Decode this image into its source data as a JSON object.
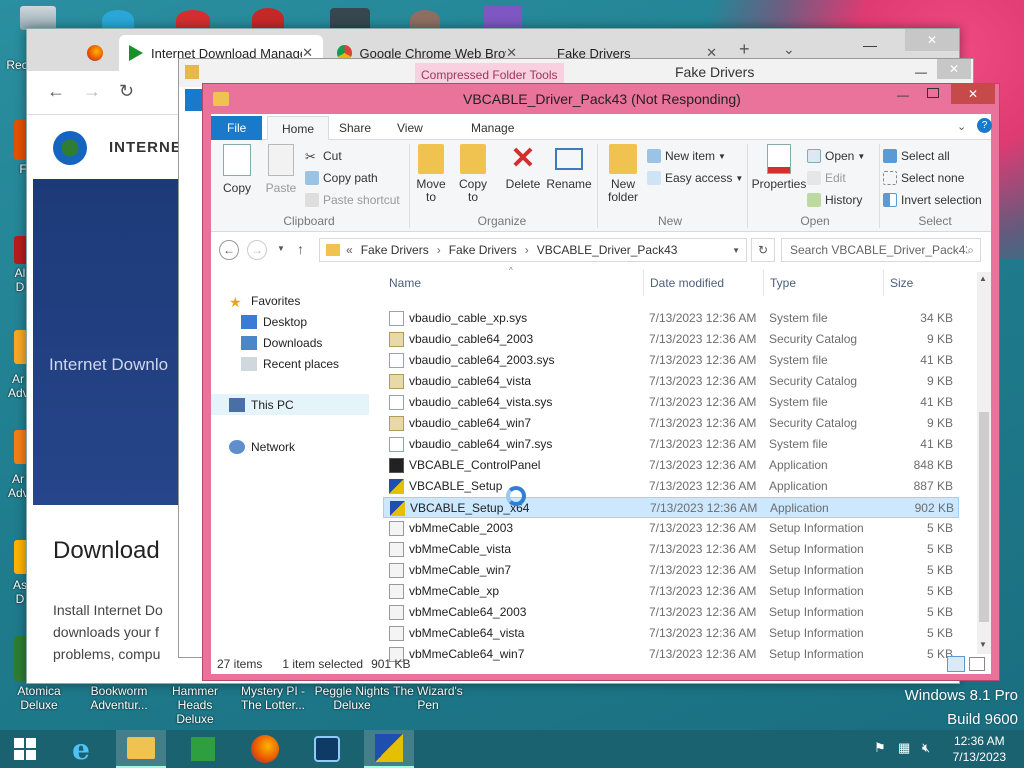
{
  "desktop": {
    "top_icons_labels": [],
    "left_icons": [
      {
        "label": "Rec",
        "name": "recycle-bin-icon"
      },
      {
        "label": "F",
        "name": "app-icon-f"
      },
      {
        "label": "Al D",
        "name": "app-icon-al"
      },
      {
        "label": "Ar Adv",
        "name": "app-icon-ar1"
      },
      {
        "label": "Ar Adv",
        "name": "app-icon-ar2"
      },
      {
        "label": "As D",
        "name": "app-icon-as"
      }
    ],
    "bottom_icons": [
      {
        "label": "Atomica Deluxe",
        "name": "atomica-deluxe-icon"
      },
      {
        "label": "Bookworm Adventur...",
        "name": "bookworm-icon"
      },
      {
        "label": "Hammer Heads Deluxe",
        "name": "hammer-heads-icon"
      },
      {
        "label": "Mystery PI - The Lotter...",
        "name": "mystery-pi-icon"
      },
      {
        "label": "Peggle Nights Deluxe",
        "name": "peggle-nights-icon"
      },
      {
        "label": "The Wizard's Pen",
        "name": "wizards-pen-icon"
      }
    ],
    "watermark_line1": "Windows 8.1 Pro",
    "watermark_line2": "Build 9600"
  },
  "taskbar": {
    "time": "12:36 AM",
    "date": "7/13/2023"
  },
  "browser": {
    "tabs": [
      {
        "label": "",
        "name": "tab-firefox-blank"
      },
      {
        "label": "Internet Download Manage",
        "name": "tab-idm"
      },
      {
        "label": "Google Chrome Web Brows",
        "name": "tab-chrome-store"
      },
      {
        "label": "Fake Drivers",
        "name": "tab-fake-drivers"
      }
    ],
    "page_heading": "INTERNE",
    "banner_text": "Internet Downlo",
    "download_heading": "Download",
    "para_line1": "Install Internet Do",
    "para_line2": "downloads your f",
    "para_line3": "problems, compu"
  },
  "fake_drivers_window": {
    "context_tab": "Compressed Folder Tools",
    "title": "Fake Drivers"
  },
  "explorer": {
    "title": "VBCABLE_Driver_Pack43 (Not Responding)",
    "ribbon_tabs": [
      "File",
      "Home",
      "Share",
      "View",
      "Manage"
    ],
    "clipboard": {
      "copy": "Copy",
      "paste": "Paste",
      "cut": "Cut",
      "copy_path": "Copy path",
      "paste_shortcut": "Paste shortcut",
      "label": "Clipboard"
    },
    "organize": {
      "move_to": "Move",
      "move_to2": "to",
      "copy_to": "Copy",
      "copy_to2": "to",
      "delete": "Delete",
      "rename": "Rename",
      "label": "Organize"
    },
    "new": {
      "new_folder": "New",
      "new_folder2": "folder",
      "new_item": "New item",
      "easy_access": "Easy access",
      "label": "New"
    },
    "open": {
      "properties": "Properties",
      "open": "Open",
      "edit": "Edit",
      "history": "History",
      "label": "Open"
    },
    "select": {
      "select_all": "Select all",
      "select_none": "Select none",
      "invert": "Invert selection",
      "label": "Select"
    },
    "breadcrumb": [
      "Fake Drivers",
      "Fake Drivers",
      "VBCABLE_Driver_Pack43"
    ],
    "breadcrumb_prefix": "«",
    "search_placeholder": "Search VBCABLE_Driver_Pack43",
    "nav": {
      "favorites": "Favorites",
      "desktop": "Desktop",
      "downloads": "Downloads",
      "recent": "Recent places",
      "this_pc": "This PC",
      "network": "Network"
    },
    "columns": {
      "name": "Name",
      "date": "Date modified",
      "type": "Type",
      "size": "Size"
    },
    "files": [
      {
        "name": "vbaudio_cable_xp.sys",
        "date": "7/13/2023 12:36 AM",
        "type": "System file",
        "size": "34 KB",
        "icon": "sys"
      },
      {
        "name": "vbaudio_cable64_2003",
        "date": "7/13/2023 12:36 AM",
        "type": "Security Catalog",
        "size": "9 KB",
        "icon": "cat"
      },
      {
        "name": "vbaudio_cable64_2003.sys",
        "date": "7/13/2023 12:36 AM",
        "type": "System file",
        "size": "41 KB",
        "icon": "sys"
      },
      {
        "name": "vbaudio_cable64_vista",
        "date": "7/13/2023 12:36 AM",
        "type": "Security Catalog",
        "size": "9 KB",
        "icon": "cat"
      },
      {
        "name": "vbaudio_cable64_vista.sys",
        "date": "7/13/2023 12:36 AM",
        "type": "System file",
        "size": "41 KB",
        "icon": "sys"
      },
      {
        "name": "vbaudio_cable64_win7",
        "date": "7/13/2023 12:36 AM",
        "type": "Security Catalog",
        "size": "9 KB",
        "icon": "cat"
      },
      {
        "name": "vbaudio_cable64_win7.sys",
        "date": "7/13/2023 12:36 AM",
        "type": "System file",
        "size": "41 KB",
        "icon": "sys"
      },
      {
        "name": "VBCABLE_ControlPanel",
        "date": "7/13/2023 12:36 AM",
        "type": "Application",
        "size": "848 KB",
        "icon": "vb"
      },
      {
        "name": "VBCABLE_Setup",
        "date": "7/13/2023 12:36 AM",
        "type": "Application",
        "size": "887 KB",
        "icon": "setup"
      },
      {
        "name": "VBCABLE_Setup_x64",
        "date": "7/13/2023 12:36 AM",
        "type": "Application",
        "size": "902 KB",
        "icon": "setup",
        "selected": true
      },
      {
        "name": "vbMmeCable_2003",
        "date": "7/13/2023 12:36 AM",
        "type": "Setup Information",
        "size": "5 KB",
        "icon": "inf"
      },
      {
        "name": "vbMmeCable_vista",
        "date": "7/13/2023 12:36 AM",
        "type": "Setup Information",
        "size": "5 KB",
        "icon": "inf"
      },
      {
        "name": "vbMmeCable_win7",
        "date": "7/13/2023 12:36 AM",
        "type": "Setup Information",
        "size": "5 KB",
        "icon": "inf"
      },
      {
        "name": "vbMmeCable_xp",
        "date": "7/13/2023 12:36 AM",
        "type": "Setup Information",
        "size": "5 KB",
        "icon": "inf"
      },
      {
        "name": "vbMmeCable64_2003",
        "date": "7/13/2023 12:36 AM",
        "type": "Setup Information",
        "size": "5 KB",
        "icon": "inf"
      },
      {
        "name": "vbMmeCable64_vista",
        "date": "7/13/2023 12:36 AM",
        "type": "Setup Information",
        "size": "5 KB",
        "icon": "inf"
      },
      {
        "name": "vbMmeCable64_win7",
        "date": "7/13/2023 12:36 AM",
        "type": "Setup Information",
        "size": "5 KB",
        "icon": "inf"
      }
    ],
    "status": {
      "count": "27 items",
      "selected": "1 item selected",
      "selected_size": "901 KB"
    }
  },
  "colors": {
    "accent": "#1979ca",
    "window_frame": "#e9739a",
    "taskbar": "#1a6270",
    "selection": "#cce8ff"
  }
}
